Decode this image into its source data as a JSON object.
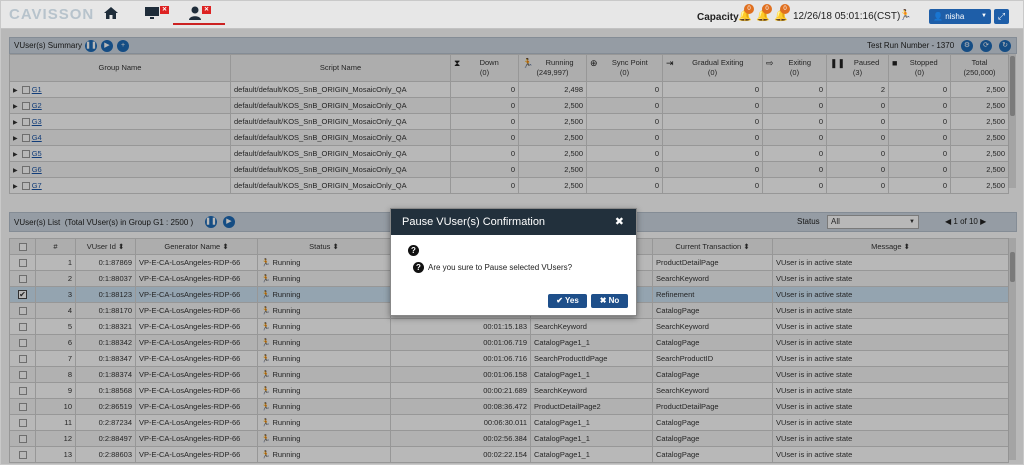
{
  "app": {
    "logo": "CAVISSON"
  },
  "header": {
    "capacity_label": "Capacity",
    "bells": [
      {
        "count": "0"
      },
      {
        "count": "0"
      },
      {
        "count": "0"
      }
    ],
    "datetime": "12/26/18 05:01:16(CST)",
    "user": "nisha"
  },
  "summary": {
    "title": "VUser(s) Summary",
    "test_run_label": "Test Run Number - 1370",
    "columns": [
      {
        "label": "Group Name",
        "sub": ""
      },
      {
        "label": "Script Name",
        "sub": ""
      },
      {
        "label": "Down",
        "sub": "(0)"
      },
      {
        "label": "Running",
        "sub": "(249,997)"
      },
      {
        "label": "Sync Point",
        "sub": "(0)"
      },
      {
        "label": "Gradual Exiting",
        "sub": "(0)"
      },
      {
        "label": "Exiting",
        "sub": "(0)"
      },
      {
        "label": "Paused",
        "sub": "(3)"
      },
      {
        "label": "Stopped",
        "sub": "(0)"
      },
      {
        "label": "Total",
        "sub": "(250,000)"
      }
    ],
    "rows": [
      {
        "group": "G1",
        "script": "default/default/KOS_SnB_ORIGIN_MosaicOnly_QA",
        "down": "0",
        "running": "2,498",
        "sync": "0",
        "gradual": "0",
        "exiting": "0",
        "paused": "2",
        "stopped": "0",
        "total": "2,500"
      },
      {
        "group": "G2",
        "script": "default/default/KOS_SnB_ORIGIN_MosaicOnly_QA",
        "down": "0",
        "running": "2,500",
        "sync": "0",
        "gradual": "0",
        "exiting": "0",
        "paused": "0",
        "stopped": "0",
        "total": "2,500"
      },
      {
        "group": "G3",
        "script": "default/default/KOS_SnB_ORIGIN_MosaicOnly_QA",
        "down": "0",
        "running": "2,500",
        "sync": "0",
        "gradual": "0",
        "exiting": "0",
        "paused": "0",
        "stopped": "0",
        "total": "2,500"
      },
      {
        "group": "G4",
        "script": "default/default/KOS_SnB_ORIGIN_MosaicOnly_QA",
        "down": "0",
        "running": "2,500",
        "sync": "0",
        "gradual": "0",
        "exiting": "0",
        "paused": "0",
        "stopped": "0",
        "total": "2,500"
      },
      {
        "group": "G5",
        "script": "default/default/KOS_SnB_ORIGIN_MosaicOnly_QA",
        "down": "0",
        "running": "2,500",
        "sync": "0",
        "gradual": "0",
        "exiting": "0",
        "paused": "0",
        "stopped": "0",
        "total": "2,500"
      },
      {
        "group": "G6",
        "script": "default/default/KOS_SnB_ORIGIN_MosaicOnly_QA",
        "down": "0",
        "running": "2,500",
        "sync": "0",
        "gradual": "0",
        "exiting": "0",
        "paused": "0",
        "stopped": "0",
        "total": "2,500"
      },
      {
        "group": "G7",
        "script": "default/default/KOS_SnB_ORIGIN_MosaicOnly_QA",
        "down": "0",
        "running": "2,500",
        "sync": "0",
        "gradual": "0",
        "exiting": "0",
        "paused": "0",
        "stopped": "0",
        "total": "2,500"
      }
    ]
  },
  "list": {
    "title": "VUser(s) List",
    "subtitle": "(Total VUser(s) in Group G1 : 2500 )",
    "status_label": "Status",
    "status_value": "All",
    "pager": "1 of 10",
    "columns": [
      "#",
      "VUser Id",
      "Generator Name",
      "Status",
      "Current Transaction",
      "Message"
    ],
    "rows": [
      {
        "n": "1",
        "id": "0:1:87869",
        "gen": "VP-E-CA-LosAngeles-RDP-66",
        "status": "Running",
        "time": "",
        "page": "",
        "txn": "ProductDetailPage",
        "msg": "VUser is in active state",
        "checked": false
      },
      {
        "n": "2",
        "id": "0:1:88037",
        "gen": "VP-E-CA-LosAngeles-RDP-66",
        "status": "Running",
        "time": "",
        "page": "",
        "txn": "SearchKeyword",
        "msg": "VUser is in active state",
        "checked": false
      },
      {
        "n": "3",
        "id": "0:1:88123",
        "gen": "VP-E-CA-LosAngeles-RDP-66",
        "status": "Running",
        "time": "",
        "page": "",
        "txn": "Refinement",
        "msg": "VUser is in active state",
        "checked": true
      },
      {
        "n": "4",
        "id": "0:1:88170",
        "gen": "VP-E-CA-LosAngeles-RDP-66",
        "status": "Running",
        "time": "",
        "page": "",
        "txn": "CatalogPage",
        "msg": "VUser is in active state",
        "checked": false
      },
      {
        "n": "5",
        "id": "0:1:88321",
        "gen": "VP-E-CA-LosAngeles-RDP-66",
        "status": "Running",
        "time": "00:01:15.183",
        "page": "SearchKeyword",
        "txn": "SearchKeyword",
        "msg": "VUser is in active state",
        "checked": false
      },
      {
        "n": "6",
        "id": "0:1:88342",
        "gen": "VP-E-CA-LosAngeles-RDP-66",
        "status": "Running",
        "time": "00:01:06.719",
        "page": "CatalogPage1_1",
        "txn": "CatalogPage",
        "msg": "VUser is in active state",
        "checked": false
      },
      {
        "n": "7",
        "id": "0:1:88347",
        "gen": "VP-E-CA-LosAngeles-RDP-66",
        "status": "Running",
        "time": "00:01:06.716",
        "page": "SearchProductIdPage",
        "txn": "SearchProductID",
        "msg": "VUser is in active state",
        "checked": false
      },
      {
        "n": "8",
        "id": "0:1:88374",
        "gen": "VP-E-CA-LosAngeles-RDP-66",
        "status": "Running",
        "time": "00:01:06.158",
        "page": "CatalogPage1_1",
        "txn": "CatalogPage",
        "msg": "VUser is in active state",
        "checked": false
      },
      {
        "n": "9",
        "id": "0:1:88568",
        "gen": "VP-E-CA-LosAngeles-RDP-66",
        "status": "Running",
        "time": "00:00:21.689",
        "page": "SearchKeyword",
        "txn": "SearchKeyword",
        "msg": "VUser is in active state",
        "checked": false
      },
      {
        "n": "10",
        "id": "0:2:86519",
        "gen": "VP-E-CA-LosAngeles-RDP-66",
        "status": "Running",
        "time": "00:08:36.472",
        "page": "ProductDetailPage2",
        "txn": "ProductDetailPage",
        "msg": "VUser is in active state",
        "checked": false
      },
      {
        "n": "11",
        "id": "0:2:87234",
        "gen": "VP-E-CA-LosAngeles-RDP-66",
        "status": "Running",
        "time": "00:06:30.011",
        "page": "CatalogPage1_1",
        "txn": "CatalogPage",
        "msg": "VUser is in active state",
        "checked": false
      },
      {
        "n": "12",
        "id": "0:2:88497",
        "gen": "VP-E-CA-LosAngeles-RDP-66",
        "status": "Running",
        "time": "00:02:56.384",
        "page": "CatalogPage1_1",
        "txn": "CatalogPage",
        "msg": "VUser is in active state",
        "checked": false
      },
      {
        "n": "13",
        "id": "0:2:88603",
        "gen": "VP-E-CA-LosAngeles-RDP-66",
        "status": "Running",
        "time": "00:02:22.154",
        "page": "CatalogPage1_1",
        "txn": "CatalogPage",
        "msg": "VUser is in active state",
        "checked": false
      }
    ]
  },
  "dialog": {
    "title": "Pause VUser(s) Confirmation",
    "message": "Are you sure to Pause selected VUsers?",
    "yes_label": "Yes",
    "no_label": "No"
  },
  "icons": {
    "home": "home-icon",
    "monitor": "monitor-icon",
    "user": "user-icon",
    "bell": "bell-icon",
    "help": "question-icon"
  },
  "colors": {
    "accent": "#1e5ea8",
    "dialog_header": "#22303c",
    "badge": "#e07020",
    "tab_red": "#cc2222"
  }
}
